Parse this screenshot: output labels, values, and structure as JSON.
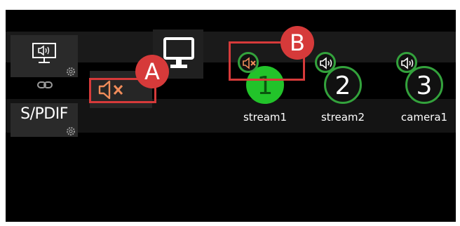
{
  "sources": {
    "spdif_label": "S/PDIF"
  },
  "streams": [
    {
      "number": "1",
      "label": "stream1",
      "active": true,
      "audio_state": "muted"
    },
    {
      "number": "2",
      "label": "stream2",
      "active": false,
      "audio_state": "unmuted"
    },
    {
      "number": "3",
      "label": "camera1",
      "active": false,
      "audio_state": "unmuted"
    }
  ],
  "annotations": {
    "a_label": "A",
    "b_label": "B"
  },
  "icons": {
    "hdmi_audio": "monitor-speaker-icon",
    "link": "link-icon",
    "settings": "gear-icon",
    "muted": "speaker-muted-icon",
    "unmuted": "speaker-on-icon",
    "display": "monitor-icon"
  },
  "colors": {
    "background": "#000000",
    "active_stream": "#22c32a",
    "stream_ring": "#33a23c",
    "muted_icon": "#f08c5a",
    "annotation": "#d63a3a"
  }
}
